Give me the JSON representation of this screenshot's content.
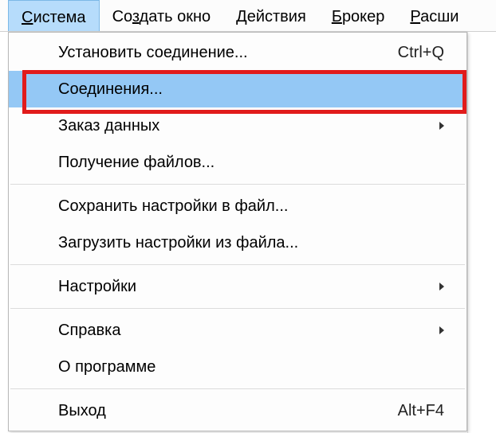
{
  "menubar": {
    "items": [
      {
        "pre": "",
        "mn": "С",
        "post": "истема",
        "active": true
      },
      {
        "pre": "Со",
        "mn": "з",
        "post": "дать окно",
        "active": false
      },
      {
        "pre": "",
        "mn": "Д",
        "post": "ействия",
        "active": false
      },
      {
        "pre": "",
        "mn": "Б",
        "post": "рокер",
        "active": false
      },
      {
        "pre": "",
        "mn": "Р",
        "post": "асши",
        "active": false
      }
    ]
  },
  "dropdown": {
    "items": [
      {
        "type": "item",
        "label": "Установить соединение...",
        "shortcut": "Ctrl+Q",
        "submenu": false,
        "selected": false
      },
      {
        "type": "item",
        "label": "Соединения...",
        "shortcut": "",
        "submenu": false,
        "selected": true
      },
      {
        "type": "item",
        "label": "Заказ данных",
        "shortcut": "",
        "submenu": true,
        "selected": false
      },
      {
        "type": "item",
        "label": "Получение файлов...",
        "shortcut": "",
        "submenu": false,
        "selected": false
      },
      {
        "type": "sep"
      },
      {
        "type": "item",
        "label": "Сохранить настройки в файл...",
        "shortcut": "",
        "submenu": false,
        "selected": false
      },
      {
        "type": "item",
        "label": "Загрузить настройки из файла...",
        "shortcut": "",
        "submenu": false,
        "selected": false
      },
      {
        "type": "sep"
      },
      {
        "type": "item",
        "label": "Настройки",
        "shortcut": "",
        "submenu": true,
        "selected": false
      },
      {
        "type": "sep"
      },
      {
        "type": "item",
        "label": "Справка",
        "shortcut": "",
        "submenu": true,
        "selected": false
      },
      {
        "type": "item",
        "label": "О программе",
        "shortcut": "",
        "submenu": false,
        "selected": false
      },
      {
        "type": "sep"
      },
      {
        "type": "item",
        "label": "Выход",
        "shortcut": "Alt+F4",
        "submenu": false,
        "selected": false
      }
    ]
  }
}
